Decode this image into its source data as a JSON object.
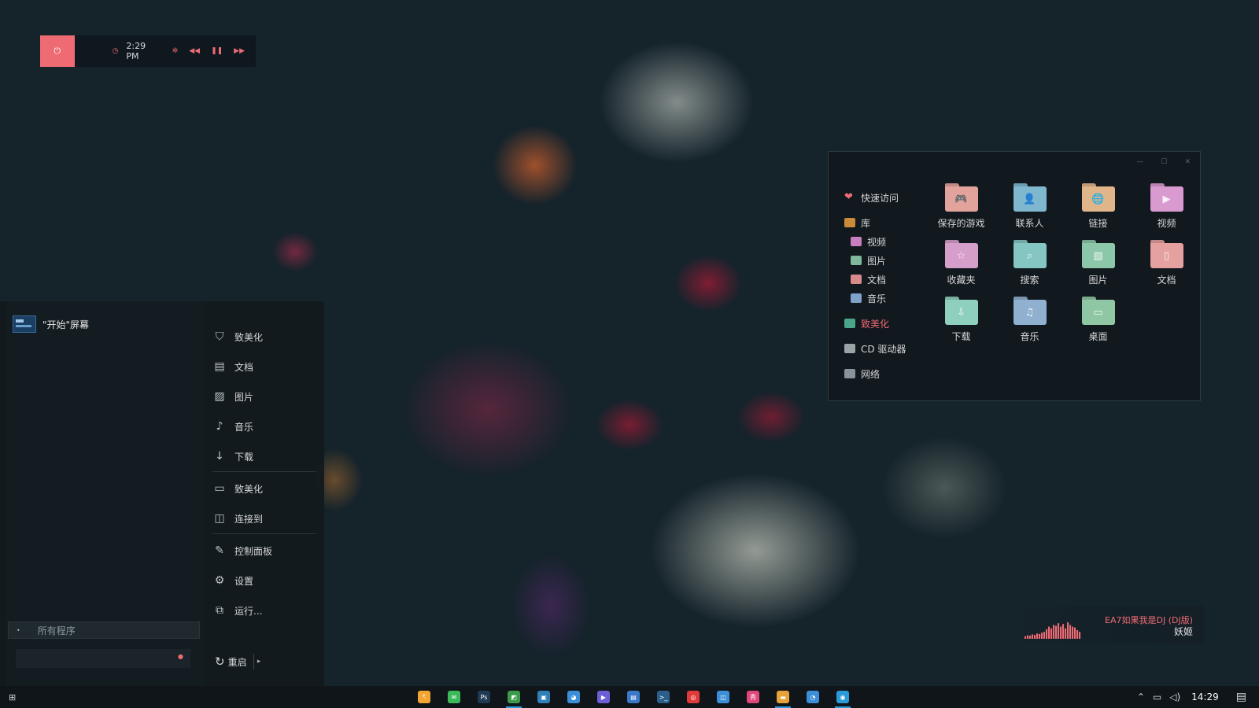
{
  "top_widget": {
    "time": "2:29 PM",
    "accent": "#ef6b74"
  },
  "explorer": {
    "nav": {
      "quick_access": "快速访问",
      "library": "库",
      "videos": "视频",
      "pictures": "图片",
      "documents": "文档",
      "music": "音乐",
      "this_pc": "致美化",
      "cd_drive": "CD 驱动器",
      "network": "网络"
    },
    "folders": [
      {
        "label": "保存的游戏",
        "icon": "gamepad-icon",
        "color": "#e2a39c"
      },
      {
        "label": "联系人",
        "icon": "person-icon",
        "color": "#7fb7cf"
      },
      {
        "label": "链接",
        "icon": "globe-icon",
        "color": "#e0b58a"
      },
      {
        "label": "视频",
        "icon": "video-icon",
        "color": "#d99ad0"
      },
      {
        "label": "收藏夹",
        "icon": "star-icon",
        "color": "#d69ecb"
      },
      {
        "label": "搜索",
        "icon": "search-icon",
        "color": "#86c6c2"
      },
      {
        "label": "图片",
        "icon": "image-icon",
        "color": "#8cc7a9"
      },
      {
        "label": "文档",
        "icon": "document-icon",
        "color": "#e5a0a0"
      },
      {
        "label": "下载",
        "icon": "download-icon",
        "color": "#8fcfbd"
      },
      {
        "label": "音乐",
        "icon": "music-note-icon",
        "color": "#8fb0cf"
      },
      {
        "label": "桌面",
        "icon": "desktop-icon",
        "color": "#8fc7a4"
      }
    ]
  },
  "start_menu": {
    "start_screen": "\"开始\"屏幕",
    "all_programs": "所有程序",
    "search_placeholder": "",
    "items": {
      "beautify": "致美化",
      "documents": "文档",
      "pictures": "图片",
      "music": "音乐",
      "downloads": "下载",
      "computer": "致美化",
      "connect": "连接到",
      "control_panel": "控制面板",
      "settings": "设置",
      "run": "运行..."
    },
    "restart": "重启"
  },
  "music_widget": {
    "song": "EA7如果我是DJ (DJ版)",
    "artist": "妖姬",
    "eq_levels": [
      0.15,
      0.2,
      0.18,
      0.25,
      0.22,
      0.3,
      0.28,
      0.35,
      0.4,
      0.55,
      0.7,
      0.6,
      0.8,
      0.75,
      0.9,
      0.7,
      0.85,
      0.6,
      0.95,
      0.8,
      0.7,
      0.65,
      0.5,
      0.4
    ]
  },
  "taskbar": {
    "apps": [
      {
        "icon": "vpn-app-icon",
        "color": "#f2a533",
        "glyph": "ৎ",
        "active": false
      },
      {
        "icon": "wechat-icon",
        "color": "#3cba5a",
        "glyph": "✉",
        "active": false
      },
      {
        "icon": "photoshop-icon",
        "color": "#1f3a55",
        "glyph": "Ps",
        "active": false
      },
      {
        "icon": "image-editor-icon",
        "color": "#3c9b4b",
        "glyph": "◩",
        "active": true
      },
      {
        "icon": "photo-viewer-icon",
        "color": "#2f7fb8",
        "glyph": "▣",
        "active": false
      },
      {
        "icon": "paint-icon",
        "color": "#3a8fd8",
        "glyph": "◕",
        "active": false
      },
      {
        "icon": "player-icon",
        "color": "#6b5fd6",
        "glyph": "▶",
        "active": false
      },
      {
        "icon": "notepad-icon",
        "color": "#3a78c8",
        "glyph": "▤",
        "active": false
      },
      {
        "icon": "terminal-icon",
        "color": "#2b5f8a",
        "glyph": ">_",
        "active": false
      },
      {
        "icon": "netease-music-icon",
        "color": "#e23a3a",
        "glyph": "◎",
        "active": false
      },
      {
        "icon": "window-manager-icon",
        "color": "#3a8fd8",
        "glyph": "◫",
        "active": false
      },
      {
        "icon": "meitu-icon",
        "color": "#e0487a",
        "glyph": "秀",
        "active": false
      },
      {
        "icon": "file-explorer-icon",
        "color": "#e8a23a",
        "glyph": "▬",
        "active": true
      },
      {
        "icon": "qq-icon",
        "color": "#3a8fd8",
        "glyph": "◔",
        "active": false
      },
      {
        "icon": "chrome-icon",
        "color": "#2a9bd9",
        "glyph": "◉",
        "active": true
      }
    ],
    "time": "14:29"
  }
}
